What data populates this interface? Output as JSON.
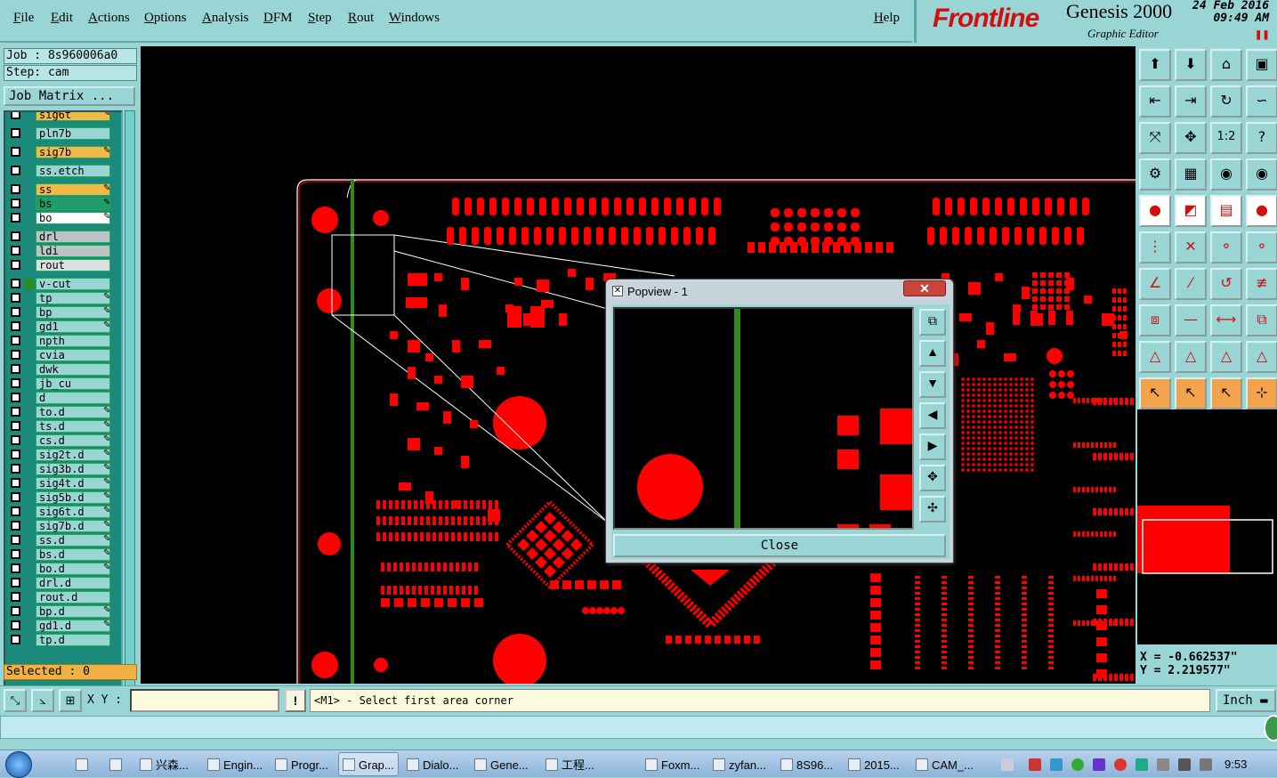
{
  "menu": {
    "items": [
      "File",
      "Edit",
      "Actions",
      "Options",
      "Analysis",
      "DFM",
      "Step",
      "Rout",
      "Windows"
    ],
    "help": "Help"
  },
  "brand": {
    "logo": "Frontline",
    "title": "Genesis 2000",
    "subtitle": "Graphic Editor",
    "date": "24 Feb 2016",
    "time": "09:49  AM"
  },
  "panel": {
    "job": "Job : 8s960006a0",
    "step": "Step: cam",
    "job_matrix": "Job Matrix ...",
    "selected": "Selected : 0"
  },
  "layers": [
    {
      "name": "sig6t",
      "color": "#f3b84a",
      "pen": true
    },
    {
      "name": "pln7b",
      "color": "#9ad5d5",
      "pen": false
    },
    {
      "name": "sig7b",
      "color": "#f3b84a",
      "pen": true
    },
    {
      "name": "ss.etch",
      "color": "#9ad5d5",
      "pen": false
    },
    {
      "name": "ss",
      "color": "#f3b84a",
      "pen": true
    },
    {
      "name": "bs",
      "color": "#1f9c6a",
      "pen": true
    },
    {
      "name": "bo",
      "color": "#ffffff",
      "pen": true
    },
    {
      "name": "drl",
      "color": "#b9c4c4",
      "pen": false
    },
    {
      "name": "ldi",
      "color": "#b9c4c4",
      "pen": false
    },
    {
      "name": "rout",
      "color": "#d8e0e0",
      "pen": false
    },
    {
      "name": "v-cut",
      "color": "#9ad5d5",
      "pen": false
    },
    {
      "name": "tp",
      "color": "#9ad5d5",
      "pen": true
    },
    {
      "name": "bp",
      "color": "#9ad5d5",
      "pen": true
    },
    {
      "name": "gd1",
      "color": "#9ad5d5",
      "pen": true
    },
    {
      "name": "npth",
      "color": "#9ad5d5",
      "pen": false
    },
    {
      "name": "cvia",
      "color": "#9ad5d5",
      "pen": false
    },
    {
      "name": "dwk",
      "color": "#9ad5d5",
      "pen": false
    },
    {
      "name": "jb_cu",
      "color": "#9ad5d5",
      "pen": false
    },
    {
      "name": "d",
      "color": "#9ad5d5",
      "pen": false
    },
    {
      "name": "to.d",
      "color": "#9ad5d5",
      "pen": true
    },
    {
      "name": "ts.d",
      "color": "#9ad5d5",
      "pen": true
    },
    {
      "name": "cs.d",
      "color": "#9ad5d5",
      "pen": true
    },
    {
      "name": "sig2t.d",
      "color": "#9ad5d5",
      "pen": true
    },
    {
      "name": "sig3b.d",
      "color": "#9ad5d5",
      "pen": true
    },
    {
      "name": "sig4t.d",
      "color": "#9ad5d5",
      "pen": true
    },
    {
      "name": "sig5b.d",
      "color": "#9ad5d5",
      "pen": true
    },
    {
      "name": "sig6t.d",
      "color": "#9ad5d5",
      "pen": true
    },
    {
      "name": "sig7b.d",
      "color": "#9ad5d5",
      "pen": true
    },
    {
      "name": "ss.d",
      "color": "#9ad5d5",
      "pen": true
    },
    {
      "name": "bs.d",
      "color": "#9ad5d5",
      "pen": true
    },
    {
      "name": "bo.d",
      "color": "#9ad5d5",
      "pen": true
    },
    {
      "name": "drl.d",
      "color": "#9ad5d5",
      "pen": false
    },
    {
      "name": "rout.d",
      "color": "#9ad5d5",
      "pen": false
    },
    {
      "name": "bp.d",
      "color": "#9ad5d5",
      "pen": true
    },
    {
      "name": "gd1.d",
      "color": "#9ad5d5",
      "pen": true
    },
    {
      "name": "tp.d",
      "color": "#9ad5d5",
      "pen": false
    }
  ],
  "popview": {
    "title": "Popview - 1",
    "close_label": "Close"
  },
  "tools": {
    "labels": [
      "1:2",
      "?"
    ]
  },
  "coords": {
    "x": "X = -0.662537\"",
    "y": "Y = 2.219577\""
  },
  "cmdbar": {
    "xy_label": "X Y :",
    "bang": "!",
    "prompt": "<M1> - Select first area corner",
    "units": "Inch"
  },
  "taskbar": {
    "items": [
      "兴森...",
      "Engin...",
      "Progr...",
      "Grap...",
      "Dialo...",
      "Gene...",
      "工程...",
      "Foxm...",
      "zyfan...",
      "8S96...",
      "2015...",
      "CAM_..."
    ],
    "active_index": 3,
    "clock": "9:53"
  },
  "colors": {
    "panel": "#9ad5d5",
    "copper": "#ff0000",
    "outline": "#ffffff",
    "vcut": "#2e8b1e",
    "brand": "#d01010"
  }
}
